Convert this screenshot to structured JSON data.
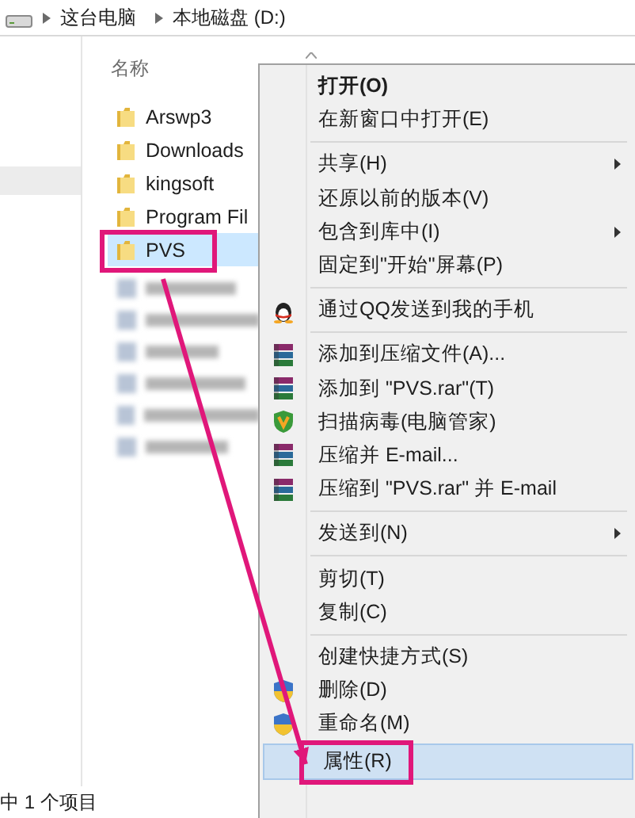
{
  "address_bar": {
    "crumbs": [
      "这台电脑",
      "本地磁盘 (D:)"
    ]
  },
  "file_list": {
    "column_header": "名称",
    "files": [
      {
        "name": "Arswp3",
        "selected": false,
        "annotated": false
      },
      {
        "name": "Downloads",
        "selected": false,
        "annotated": false
      },
      {
        "name": "kingsoft",
        "selected": false,
        "annotated": false
      },
      {
        "name": "Program Fil",
        "selected": false,
        "annotated": false
      },
      {
        "name": "PVS",
        "selected": true,
        "annotated": true
      }
    ]
  },
  "context_menu": {
    "items": [
      {
        "kind": "item",
        "label": "打开(O)",
        "bold": true,
        "submenu": false,
        "selected": false,
        "annotated": false
      },
      {
        "kind": "item",
        "label": "在新窗口中打开(E)",
        "bold": false,
        "submenu": false,
        "selected": false,
        "annotated": false
      },
      {
        "kind": "separator"
      },
      {
        "kind": "item",
        "label": "共享(H)",
        "bold": false,
        "submenu": true,
        "selected": false,
        "annotated": false
      },
      {
        "kind": "item",
        "label": "还原以前的版本(V)",
        "bold": false,
        "submenu": false,
        "selected": false,
        "annotated": false
      },
      {
        "kind": "item",
        "label": "包含到库中(I)",
        "bold": false,
        "submenu": true,
        "selected": false,
        "annotated": false
      },
      {
        "kind": "item",
        "label": "固定到\"开始\"屏幕(P)",
        "bold": false,
        "submenu": false,
        "selected": false,
        "annotated": false
      },
      {
        "kind": "separator"
      },
      {
        "kind": "qq",
        "label": "通过QQ发送到我的手机",
        "bold": false,
        "submenu": false,
        "selected": false,
        "annotated": false
      },
      {
        "kind": "separator"
      },
      {
        "kind": "archive",
        "label": "添加到压缩文件(A)...",
        "bold": false,
        "submenu": false,
        "selected": false,
        "annotated": false
      },
      {
        "kind": "archive",
        "label": "添加到 \"PVS.rar\"(T)",
        "bold": false,
        "submenu": false,
        "selected": false,
        "annotated": false
      },
      {
        "kind": "antivirus",
        "label": "扫描病毒(电脑管家)",
        "bold": false,
        "submenu": false,
        "selected": false,
        "annotated": false
      },
      {
        "kind": "archive",
        "label": "压缩并 E-mail...",
        "bold": false,
        "submenu": false,
        "selected": false,
        "annotated": false
      },
      {
        "kind": "archive",
        "label": "压缩到 \"PVS.rar\" 并 E-mail",
        "bold": false,
        "submenu": false,
        "selected": false,
        "annotated": false
      },
      {
        "kind": "separator"
      },
      {
        "kind": "item",
        "label": "发送到(N)",
        "bold": false,
        "submenu": true,
        "selected": false,
        "annotated": false
      },
      {
        "kind": "separator"
      },
      {
        "kind": "item",
        "label": "剪切(T)",
        "bold": false,
        "submenu": false,
        "selected": false,
        "annotated": false
      },
      {
        "kind": "item",
        "label": "复制(C)",
        "bold": false,
        "submenu": false,
        "selected": false,
        "annotated": false
      },
      {
        "kind": "separator"
      },
      {
        "kind": "item",
        "label": "创建快捷方式(S)",
        "bold": false,
        "submenu": false,
        "selected": false,
        "annotated": false
      },
      {
        "kind": "protected",
        "label": "删除(D)",
        "bold": false,
        "submenu": false,
        "selected": false,
        "annotated": false
      },
      {
        "kind": "protected",
        "label": "重命名(M)",
        "bold": false,
        "submenu": false,
        "selected": false,
        "annotated": false
      },
      {
        "kind": "item",
        "label": "属性(R)",
        "bold": false,
        "submenu": false,
        "selected": true,
        "annotated": true
      }
    ]
  },
  "status_bar": {
    "text": "中 1 个项目"
  }
}
